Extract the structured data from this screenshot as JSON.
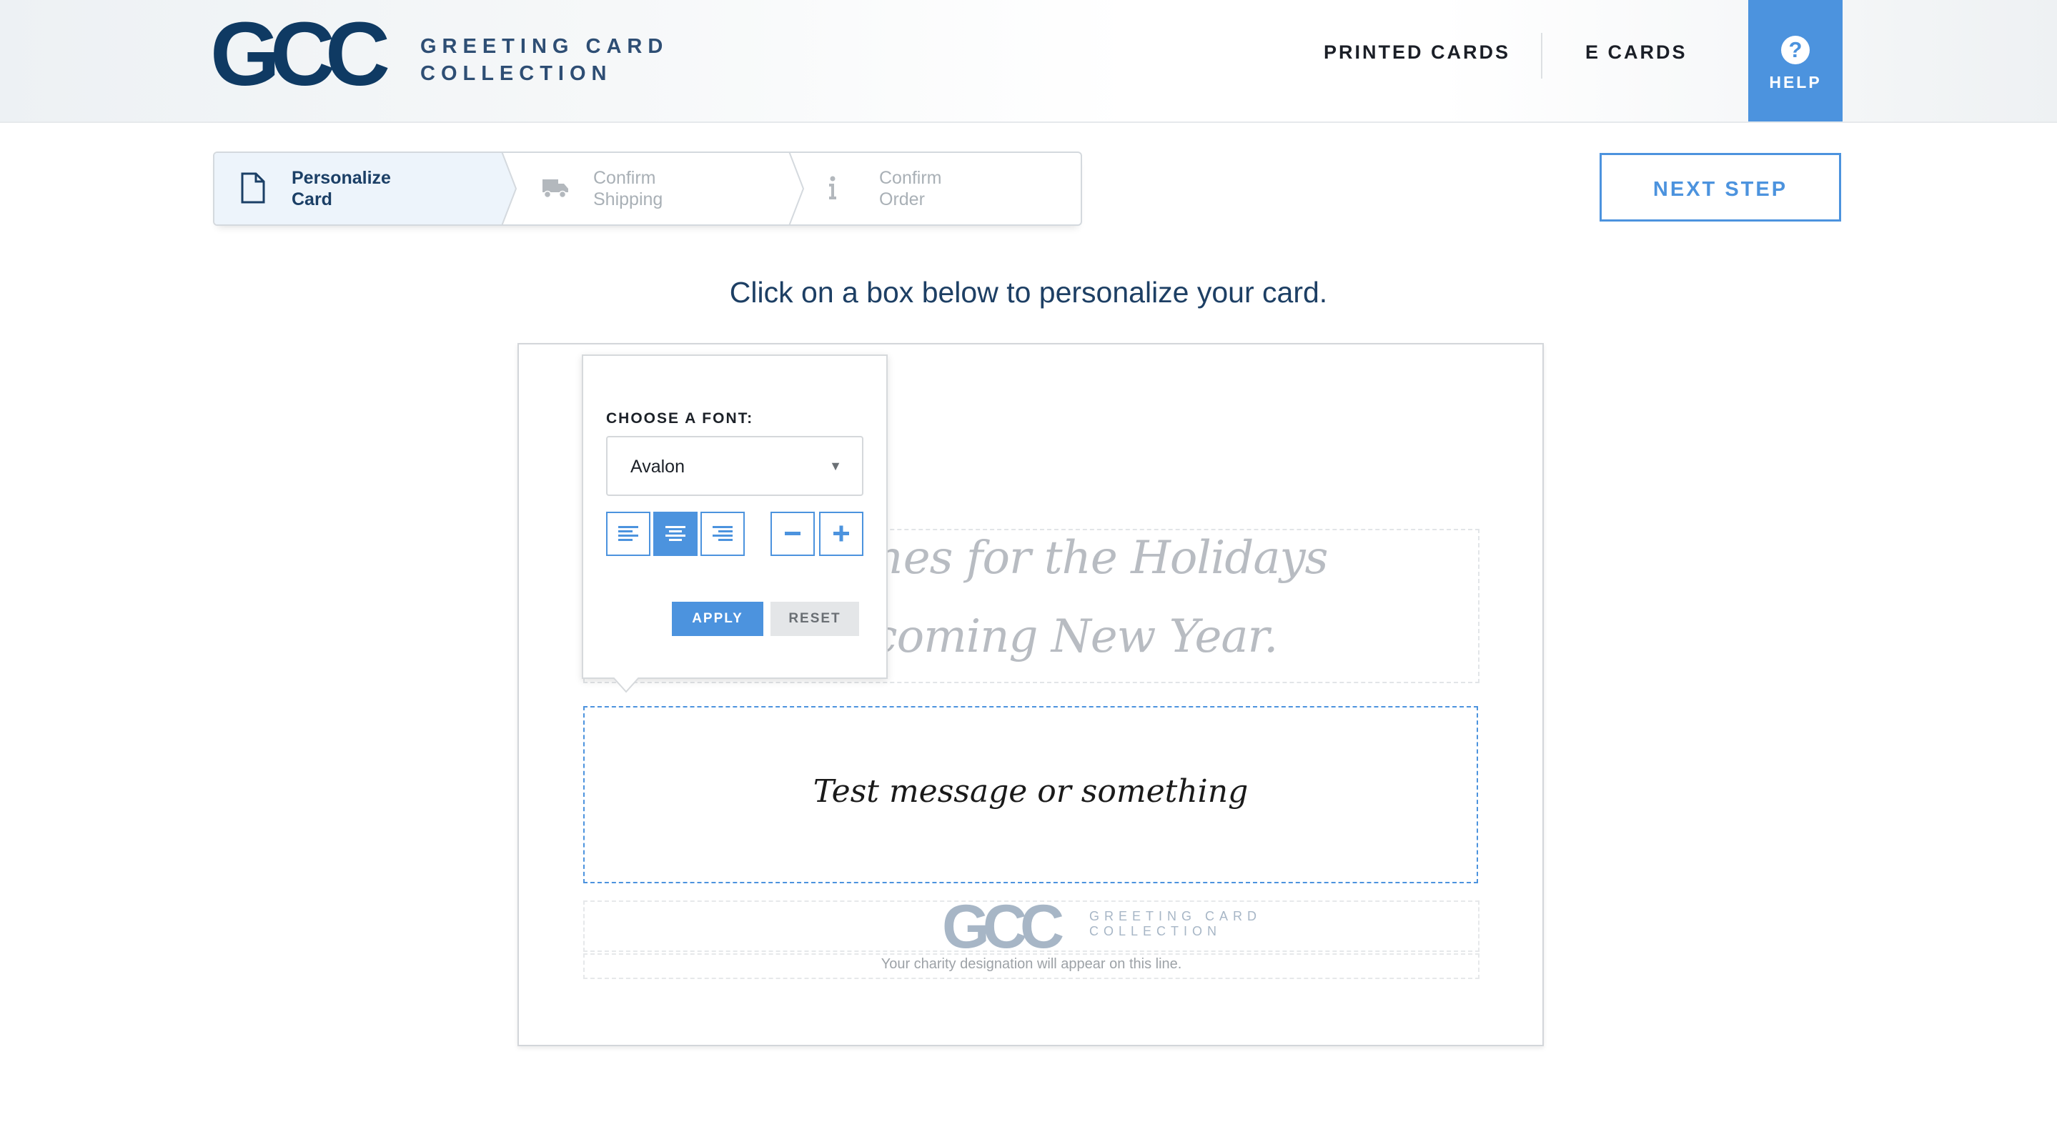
{
  "brand": {
    "logo_mark": "GCC",
    "logo_line1": "GREETING CARD",
    "logo_line2": "COLLECTION"
  },
  "nav": {
    "printed_cards": "PRINTED CARDS",
    "e_cards": "E CARDS",
    "help_label": "HELP",
    "help_glyph": "?"
  },
  "steps": [
    {
      "line1": "Personalize",
      "line2": "Card",
      "icon": "document-icon",
      "state": "active"
    },
    {
      "line1": "Confirm",
      "line2": "Shipping",
      "icon": "truck-icon",
      "state": "inactive"
    },
    {
      "line1": "Confirm",
      "line2": "Order",
      "icon": "info-icon",
      "state": "inactive"
    }
  ],
  "next_step_label": "NEXT STEP",
  "instruction": "Click on a box below to personalize your card.",
  "card": {
    "greeting_line1": "Wishes for the Holidays",
    "greeting_line2": "the coming New Year.",
    "message": "Test message or something",
    "footer_logo_mark": "GCC",
    "footer_logo_line1": "GREETING CARD",
    "footer_logo_line2": "COLLECTION",
    "charity_text": "Your charity designation will appear on this line."
  },
  "font_popover": {
    "label": "CHOOSE A FONT:",
    "selected_font": "Avalon",
    "alignment": "center",
    "apply_label": "APPLY",
    "reset_label": "RESET"
  },
  "colors": {
    "accent": "#4c93de",
    "brand_navy": "#0f3a63",
    "active_step_bg": "#edf4fb"
  }
}
